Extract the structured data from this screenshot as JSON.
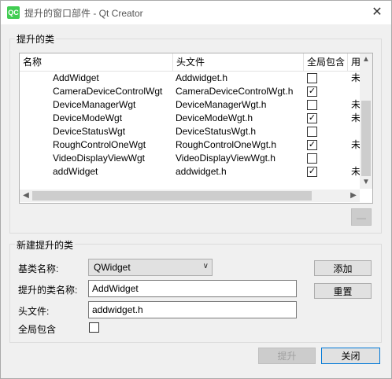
{
  "window": {
    "icon_text": "QC",
    "title": "提升的窗口部件 - Qt Creator",
    "close_glyph": "✕"
  },
  "promoted_group": {
    "title": "提升的类",
    "columns": [
      "名称",
      "头文件",
      "全局包含",
      "用"
    ],
    "rows": [
      {
        "name": "AddWidget",
        "header": "Addwidget.h",
        "global": false,
        "use": "未"
      },
      {
        "name": "CameraDeviceControlWgt",
        "header": "CameraDeviceControlWgt.h",
        "global": true,
        "use": ""
      },
      {
        "name": "DeviceManagerWgt",
        "header": "DeviceManagerWgt.h",
        "global": false,
        "use": "未"
      },
      {
        "name": "DeviceModeWgt",
        "header": "DeviceModeWgt.h",
        "global": true,
        "use": "未"
      },
      {
        "name": "DeviceStatusWgt",
        "header": "DeviceStatusWgt.h",
        "global": false,
        "use": ""
      },
      {
        "name": "RoughControlOneWgt",
        "header": "RoughControlOneWgt.h",
        "global": true,
        "use": "未"
      },
      {
        "name": "VideoDisplayViewWgt",
        "header": "VideoDisplayViewWgt.h",
        "global": false,
        "use": ""
      },
      {
        "name": "addWidget",
        "header": "addwidget.h",
        "global": true,
        "use": "未"
      }
    ],
    "remove_button_glyph": "—"
  },
  "new_group": {
    "title": "新建提升的类",
    "base_class_label": "基类名称:",
    "base_class_value": "QWidget",
    "class_name_label": "提升的类名称:",
    "class_name_value": "AddWidget",
    "header_label": "头文件:",
    "header_value": "addwidget.h",
    "global_include_label": "全局包含",
    "global_include_checked": false,
    "add_button": "添加",
    "reset_button": "重置"
  },
  "footer": {
    "promote_button": "提升",
    "close_button": "关闭"
  },
  "glyphs": {
    "check": "✓",
    "up": "▲",
    "down": "▼",
    "left": "◀",
    "right": "▶",
    "combo_arrow": "∨"
  }
}
